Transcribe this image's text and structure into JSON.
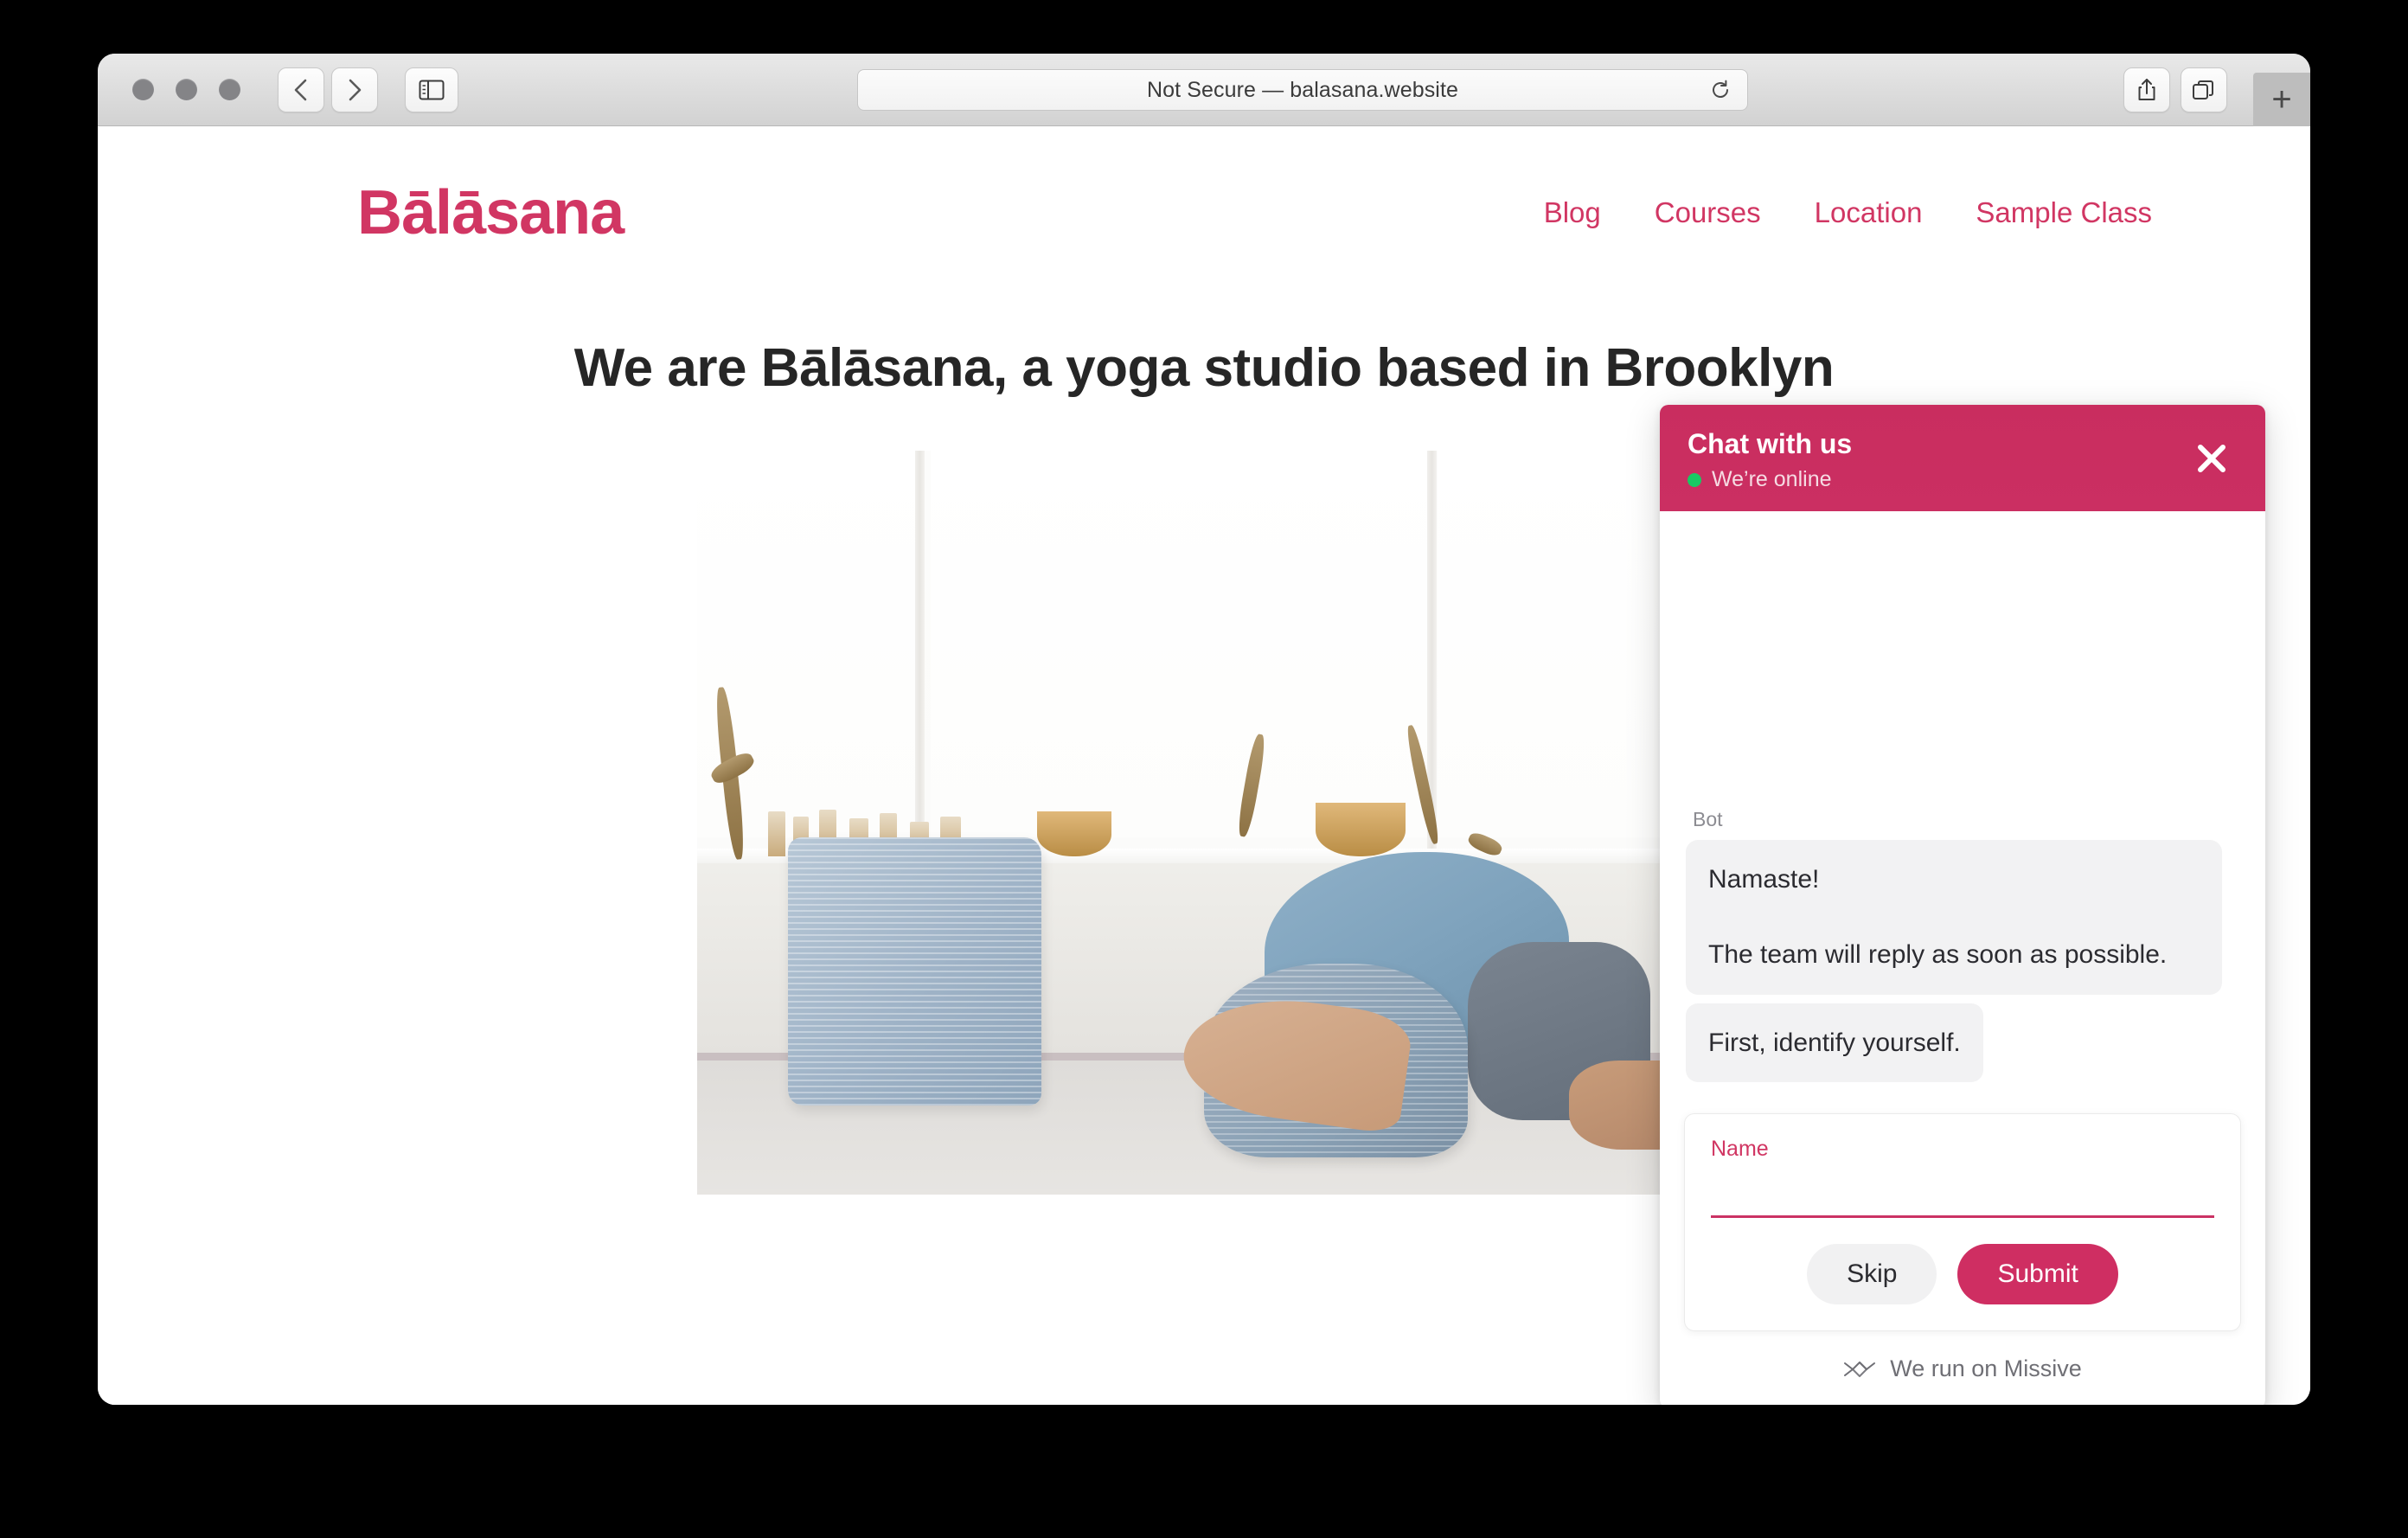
{
  "browser": {
    "address": "Not Secure — balasana.website",
    "back_label": "Back",
    "forward_label": "Forward",
    "sidebar_label": "Show sidebar",
    "reload_label": "Reload",
    "share_label": "Share",
    "tab_overview_label": "Tab overview",
    "new_tab_label": "+"
  },
  "site": {
    "logo": "Bālāsana",
    "nav": [
      {
        "label": "Blog"
      },
      {
        "label": "Courses"
      },
      {
        "label": "Location"
      },
      {
        "label": "Sample Class"
      }
    ],
    "headline": "We are Bālāsana, a yoga studio based in Brooklyn",
    "hero_alt": "Person in child's pose on blue pillows by a bright window"
  },
  "chat": {
    "title": "Chat with us",
    "status": "We’re online",
    "status_color": "#17c964",
    "accent_color": "#cf2e62",
    "close_label": "Close chat",
    "sender": "Bot",
    "messages": [
      "Namaste!\n\nThe team will reply as soon as possible.",
      "First, identify yourself."
    ],
    "form": {
      "label": "Name",
      "value": "",
      "placeholder": "",
      "skip_label": "Skip",
      "submit_label": "Submit"
    },
    "footer": "We run on Missive"
  }
}
